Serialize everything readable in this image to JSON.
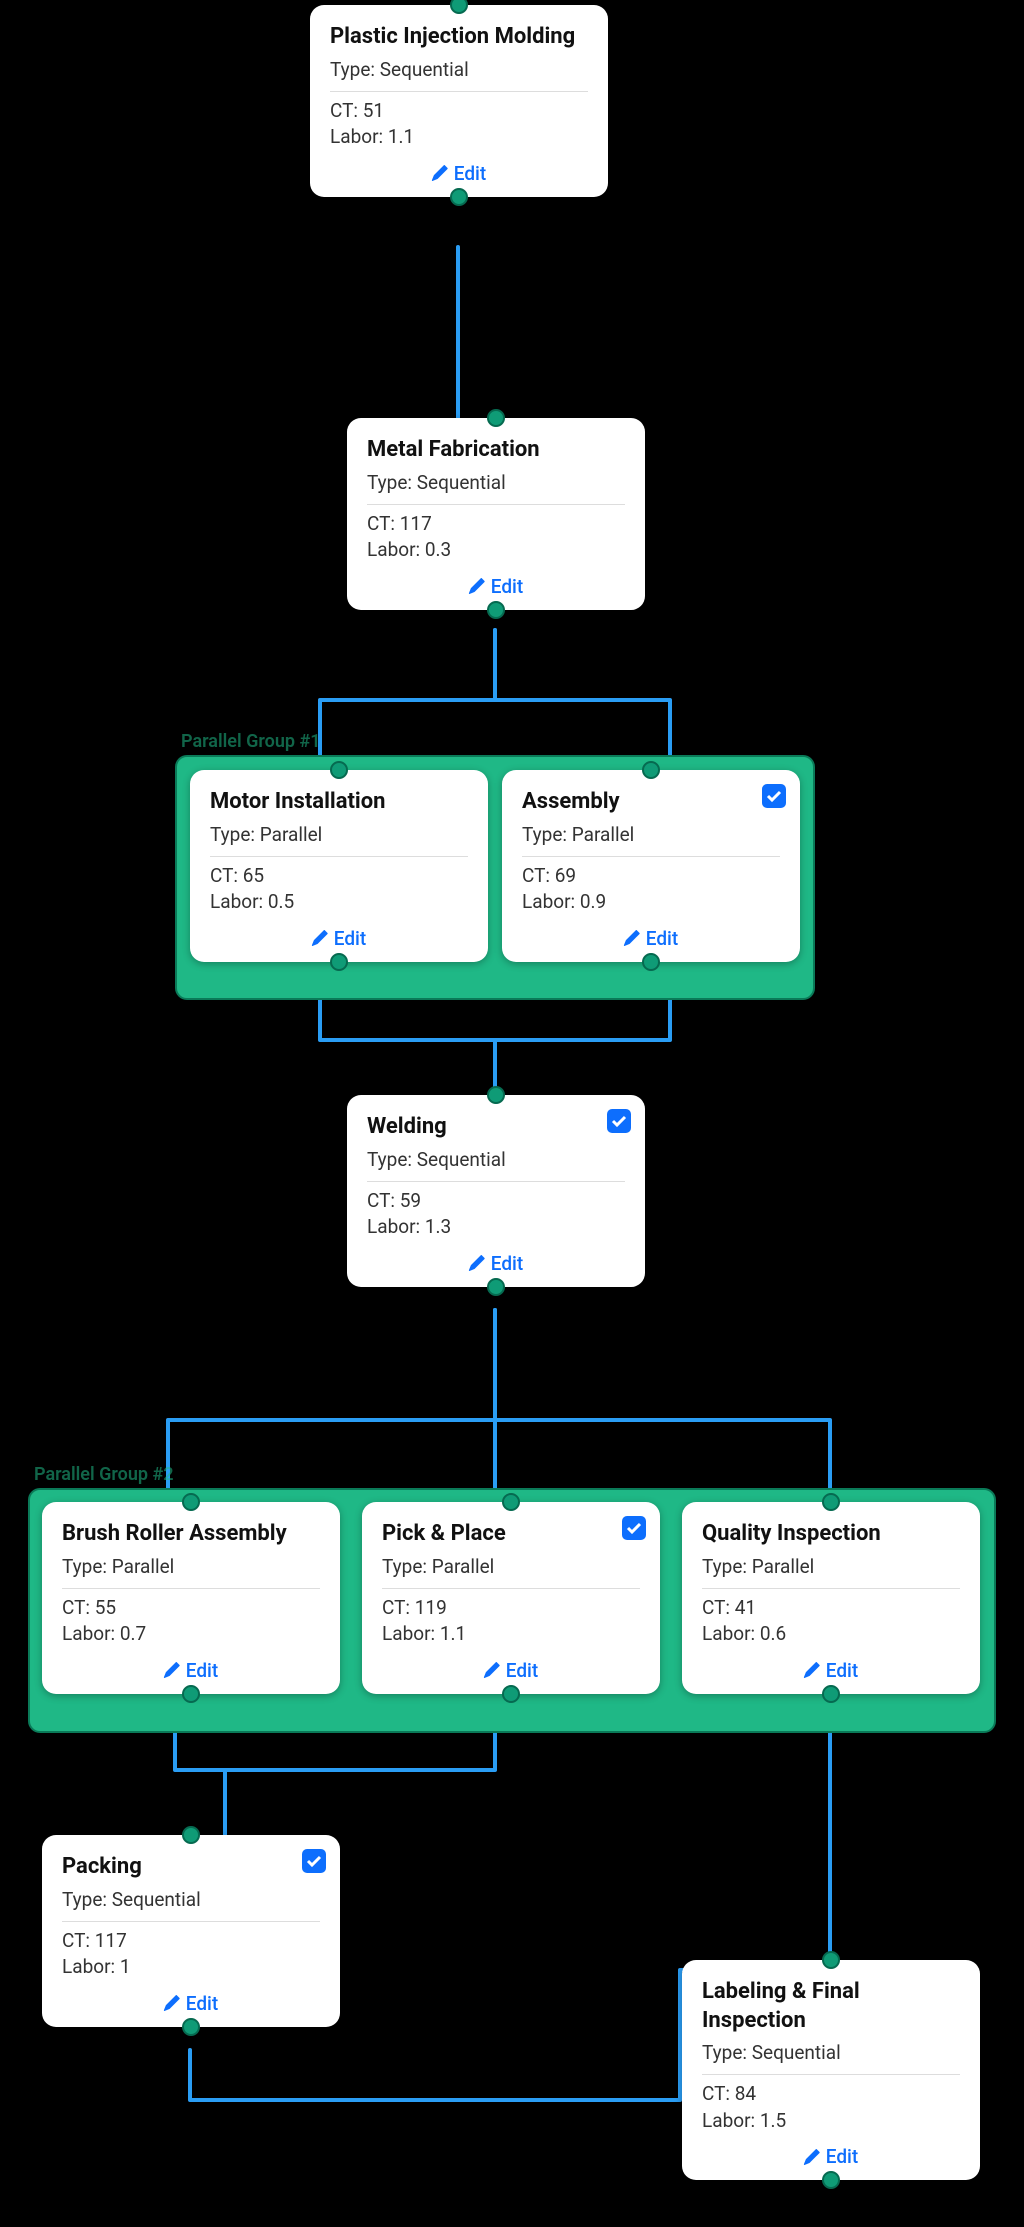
{
  "labels": {
    "edit": "Edit",
    "type_prefix": "Type: ",
    "ct_prefix": "CT: ",
    "labor_prefix": "Labor: "
  },
  "groups": [
    {
      "id": "g1",
      "label": "Parallel Group #1"
    },
    {
      "id": "g2",
      "label": "Parallel Group #2"
    }
  ],
  "nodes": {
    "n1": {
      "title": "Plastic Injection Molding",
      "type": "Sequential",
      "ct": 51,
      "labor": 1.1,
      "checked": false
    },
    "n2": {
      "title": "Metal Fabrication",
      "type": "Sequential",
      "ct": 117,
      "labor": 0.3,
      "checked": false
    },
    "n3": {
      "title": "Motor Installation",
      "type": "Parallel",
      "ct": 65,
      "labor": 0.5,
      "checked": false
    },
    "n4": {
      "title": "Assembly",
      "type": "Parallel",
      "ct": 69,
      "labor": 0.9,
      "checked": true
    },
    "n5": {
      "title": "Welding",
      "type": "Sequential",
      "ct": 59,
      "labor": 1.3,
      "checked": true
    },
    "n6": {
      "title": "Brush Roller Assembly",
      "type": "Parallel",
      "ct": 55,
      "labor": 0.7,
      "checked": false
    },
    "n7": {
      "title": "Pick & Place",
      "type": "Parallel",
      "ct": 119,
      "labor": 1.1,
      "checked": true
    },
    "n8": {
      "title": "Quality Inspection",
      "type": "Parallel",
      "ct": 41,
      "labor": 0.6,
      "checked": false
    },
    "n9": {
      "title": "Packing",
      "type": "Sequential",
      "ct": 117,
      "labor": 1,
      "checked": true
    },
    "n10": {
      "title": "Labeling & Final Inspection",
      "type": "Sequential",
      "ct": 84,
      "labor": 1.5,
      "checked": false
    }
  },
  "edges": [
    [
      "n1",
      "n2"
    ],
    [
      "n2",
      "n3"
    ],
    [
      "n2",
      "n4"
    ],
    [
      "n3",
      "n5"
    ],
    [
      "n4",
      "n5"
    ],
    [
      "n5",
      "n6"
    ],
    [
      "n5",
      "n7"
    ],
    [
      "n5",
      "n8"
    ],
    [
      "n6",
      "n9"
    ],
    [
      "n7",
      "n9"
    ],
    [
      "n8",
      "n10"
    ],
    [
      "n9",
      "n10"
    ]
  ]
}
